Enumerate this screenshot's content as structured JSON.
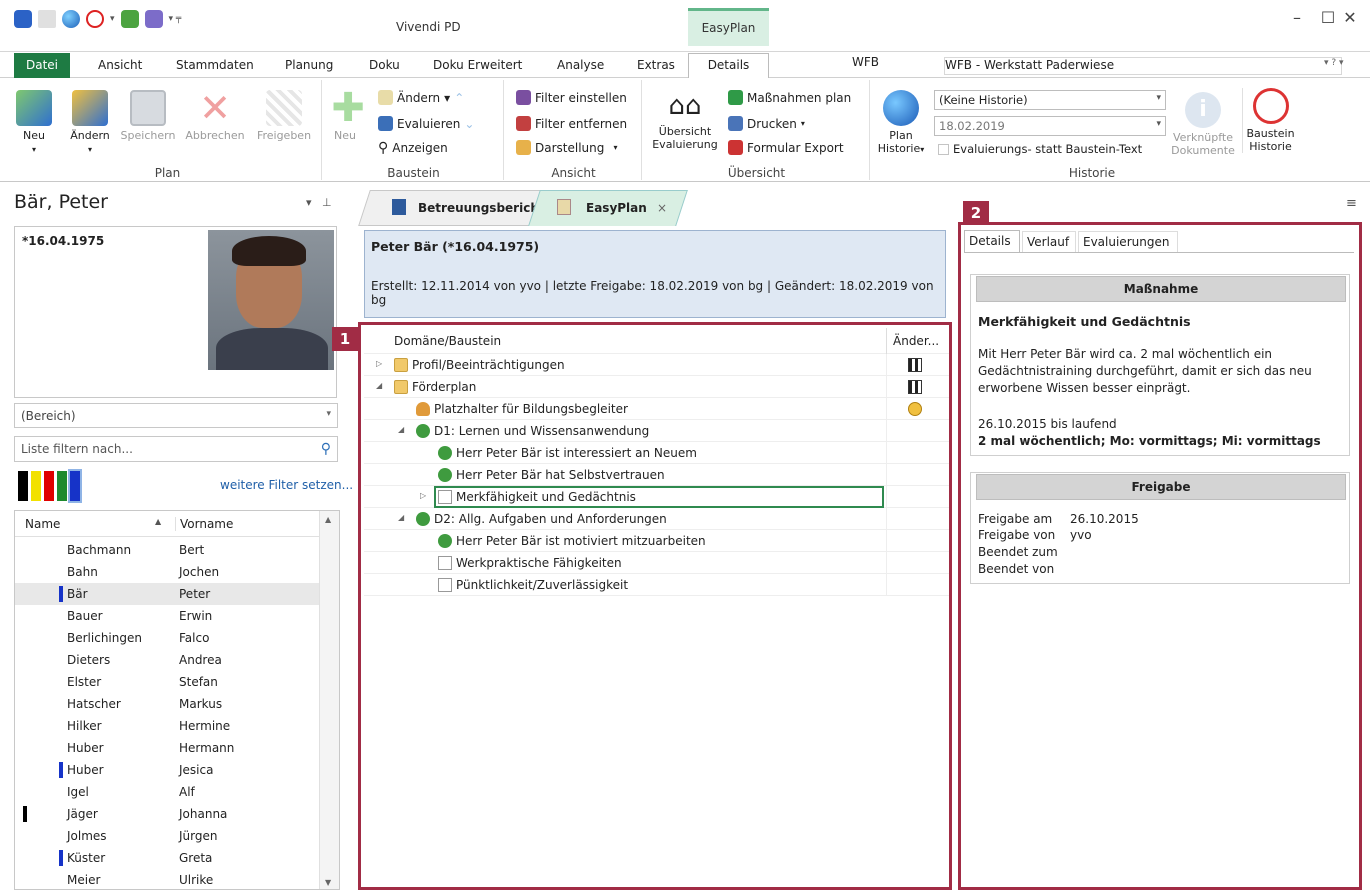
{
  "window": {
    "title": "Vivendi PD",
    "context_tab_group": "EasyPlan",
    "minimize": "–",
    "maximize": "☐",
    "close": "✕"
  },
  "menu": {
    "tabs": [
      "Datei",
      "Ansicht",
      "Stammdaten",
      "Planung",
      "Doku",
      "Doku Erweitert",
      "Analyse",
      "Extras",
      "Details"
    ],
    "active": "Details"
  },
  "facility": {
    "code": "WFB",
    "name": "WFB - Werkstatt Paderwiese",
    "options": "▾  ?  ▾"
  },
  "ribbon": {
    "plan": {
      "label": "Plan",
      "new": "Neu",
      "edit": "Ändern",
      "save": "Speichern",
      "cancel": "Abbrechen",
      "release": "Freigeben"
    },
    "baustein": {
      "label": "Baustein",
      "new": "Neu",
      "edit": "Ändern",
      "evaluate": "Evaluieren",
      "show": "Anzeigen"
    },
    "ansicht": {
      "label": "Ansicht",
      "filter_set": "Filter einstellen",
      "filter_remove": "Filter entfernen",
      "display": "Darstellung"
    },
    "uebersicht": {
      "label": "Übersicht",
      "overview_eval": "Übersicht Evaluierung",
      "measures_plan": "Maßnahmen plan",
      "print": "Drucken",
      "form_export": "Formular Export"
    },
    "historie": {
      "label": "Historie",
      "plan_history": "Plan Historie",
      "history_select": "(Keine Historie)",
      "date": "18.02.2019",
      "eval_instead": "Evaluierungs- statt Baustein-Text",
      "linked_docs": "Verknüpfte Dokumente",
      "baustein_history": "Baustein Historie"
    }
  },
  "patient": {
    "name": "Bär, Peter",
    "dob": "*16.04.1975",
    "area": "(Bereich)",
    "filter_placeholder": "Liste filtern nach...",
    "more_filters": "weitere Filter setzen...",
    "colors": [
      "#000000",
      "#f2e100",
      "#e00000",
      "#1e8a2e",
      "#1633c8"
    ],
    "columns": {
      "name": "Name",
      "vorname": "Vorname"
    },
    "list": [
      {
        "name": "Bachmann",
        "vorname": "Bert",
        "mark": ""
      },
      {
        "name": "Bahn",
        "vorname": "Jochen",
        "mark": ""
      },
      {
        "name": "Bär",
        "vorname": "Peter",
        "mark": "#1633c8",
        "selected": true
      },
      {
        "name": "Bauer",
        "vorname": "Erwin",
        "mark": ""
      },
      {
        "name": "Berlichingen",
        "vorname": "Falco",
        "mark": ""
      },
      {
        "name": "Dieters",
        "vorname": "Andrea",
        "mark": ""
      },
      {
        "name": "Elster",
        "vorname": "Stefan",
        "mark": ""
      },
      {
        "name": "Hatscher",
        "vorname": "Markus",
        "mark": ""
      },
      {
        "name": "Hilker",
        "vorname": "Hermine",
        "mark": ""
      },
      {
        "name": "Huber",
        "vorname": "Hermann",
        "mark": ""
      },
      {
        "name": "Huber",
        "vorname": "Jesica",
        "mark": "#1633c8"
      },
      {
        "name": "Igel",
        "vorname": "Alf",
        "mark": ""
      },
      {
        "name": "Jäger",
        "vorname": "Johanna",
        "mark": "#000000"
      },
      {
        "name": "Jolmes",
        "vorname": "Jürgen",
        "mark": ""
      },
      {
        "name": "Küster",
        "vorname": "Greta",
        "mark": "#1633c8"
      },
      {
        "name": "Meier",
        "vorname": "Ulrike",
        "mark": ""
      }
    ]
  },
  "doctabs": {
    "first": "Betreuungsbericht",
    "second": "EasyPlan",
    "close": "×"
  },
  "plan_header": {
    "title": "Peter Bär (*16.04.1975)",
    "meta": "Erstellt: 12.11.2014 von yvo | letzte Freigabe: 18.02.2019 von bg | Geändert: 18.02.2019 von bg"
  },
  "tree": {
    "col_domain": "Domäne/Baustein",
    "col_changed": "Änder...",
    "rows": [
      {
        "label": "Profil/Beeinträchtigungen",
        "indent": 0,
        "expander": "▷",
        "icon": "folder",
        "status": "flag"
      },
      {
        "label": "Förderplan",
        "indent": 0,
        "expander": "◢",
        "icon": "folder",
        "status": "flag"
      },
      {
        "label": "Platzhalter für Bildungsbegleiter",
        "indent": 1,
        "expander": "",
        "icon": "person",
        "status": "clock"
      },
      {
        "label": "D1: Lernen und Wissensanwendung",
        "indent": 1,
        "expander": "◢",
        "icon": "clover",
        "status": ""
      },
      {
        "label": "Herr Peter Bär ist interessiert an Neuem",
        "indent": 2,
        "expander": "",
        "icon": "clover",
        "status": ""
      },
      {
        "label": "Herr Peter Bär hat Selbstvertrauen",
        "indent": 2,
        "expander": "",
        "icon": "clover",
        "status": ""
      },
      {
        "label": "Merkfähigkeit und Gedächtnis",
        "indent": 2,
        "expander": "▷",
        "icon": "doc",
        "status": "",
        "selected": true
      },
      {
        "label": "D2: Allg. Aufgaben und Anforderungen",
        "indent": 1,
        "expander": "◢",
        "icon": "clover",
        "status": ""
      },
      {
        "label": "Herr Peter Bär ist motiviert mitzuarbeiten",
        "indent": 2,
        "expander": "",
        "icon": "clover",
        "status": ""
      },
      {
        "label": "Werkpraktische Fähigkeiten",
        "indent": 2,
        "expander": "",
        "icon": "doc",
        "status": ""
      },
      {
        "label": "Pünktlichkeit/Zuverlässigkeit",
        "indent": 2,
        "expander": "",
        "icon": "doc",
        "status": ""
      }
    ]
  },
  "markers": {
    "one": "1",
    "two": "2"
  },
  "details": {
    "tabs": [
      "Details",
      "Verlauf",
      "Evaluierungen"
    ],
    "measure_head": "Maßnahme",
    "measure_title": "Merkfähigkeit und Gedächtnis",
    "measure_text": "Mit Herr Peter Bär wird ca. 2 mal wöchentlich ein Gedächtnistraining durchgeführt, damit er sich das neu erworbene Wissen besser einprägt.",
    "period": "26.10.2015 bis laufend",
    "frequency": "2 mal wöchentlich; Mo: vormittags; Mi: vormittags",
    "release_head": "Freigabe",
    "release_on_label": "Freigabe am",
    "release_on": "26.10.2015",
    "release_by_label": "Freigabe von",
    "release_by": "yvo",
    "ended_on_label": "Beendet zum",
    "ended_by_label": "Beendet von"
  }
}
